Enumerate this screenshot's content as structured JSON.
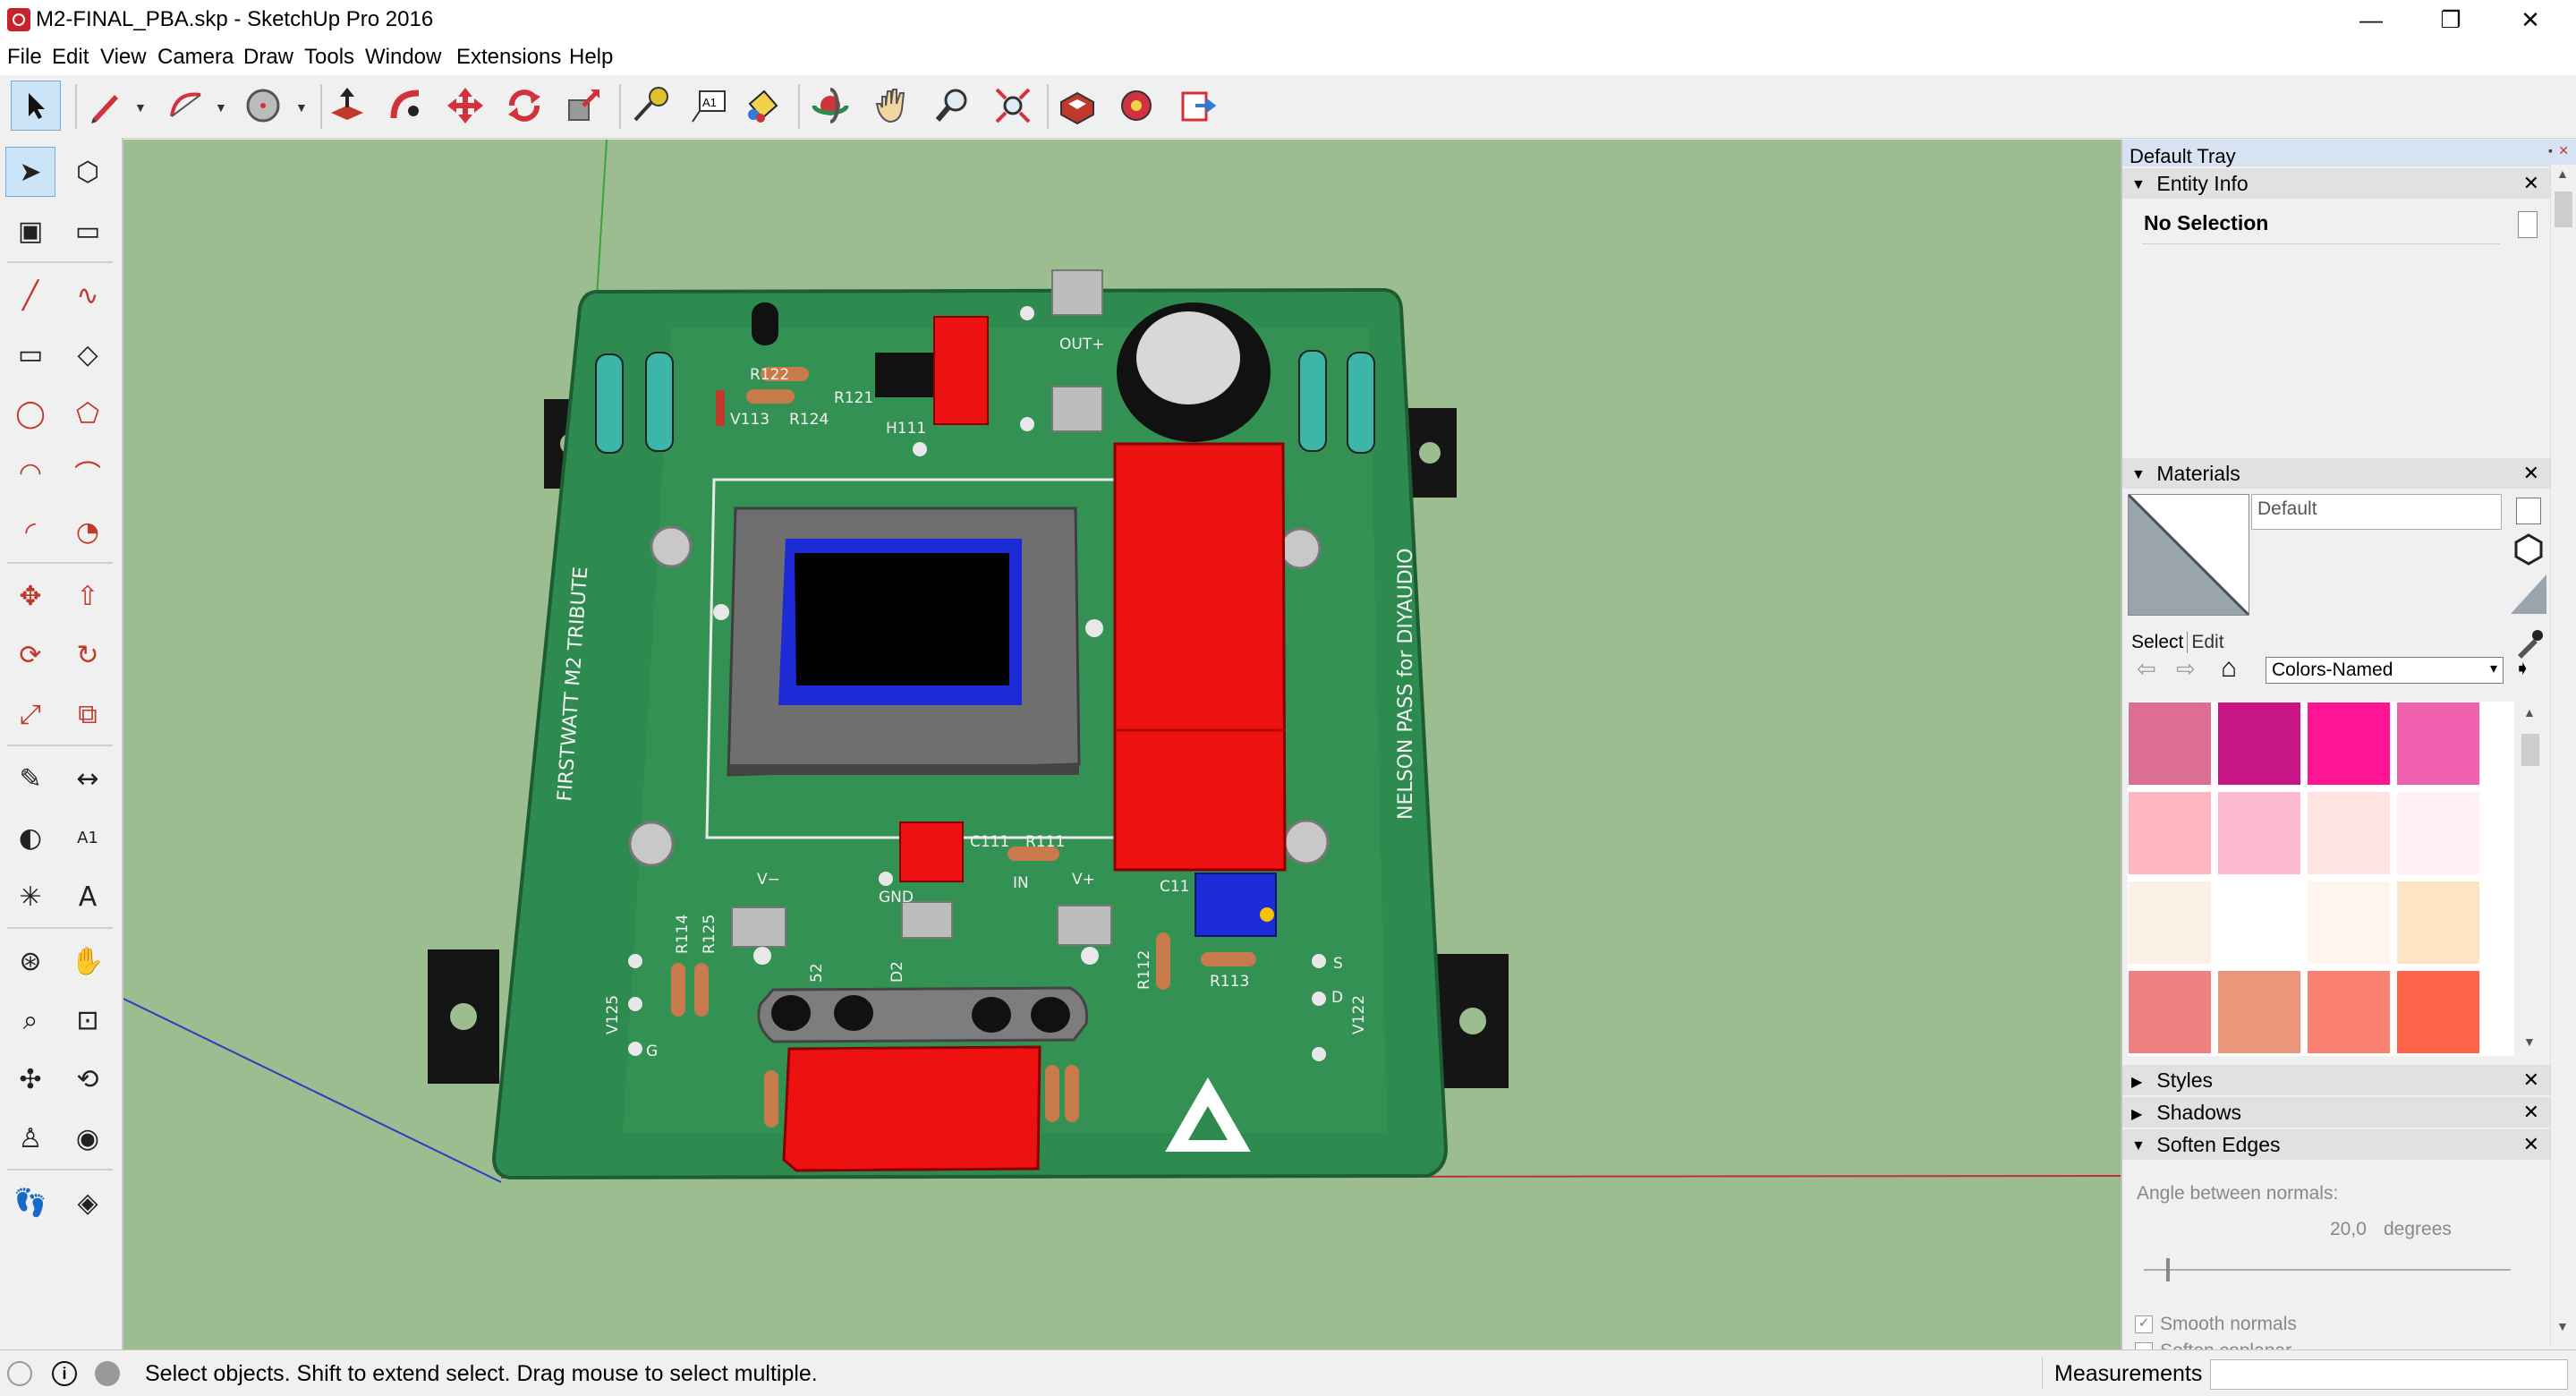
{
  "window": {
    "title": "M2-FINAL_PBA.skp - SketchUp Pro 2016",
    "controls": {
      "minimize": "—",
      "restore": "❐",
      "close": "✕"
    }
  },
  "menu": [
    "File",
    "Edit",
    "View",
    "Camera",
    "Draw",
    "Tools",
    "Window",
    "Extensions",
    "Help"
  ],
  "toolbar": {
    "tools": [
      "select",
      "pencil",
      "arc",
      "circle",
      "push-pull",
      "follow-me",
      "move",
      "rotate",
      "scale",
      "tape-measure",
      "text",
      "paint-bucket",
      "orbit",
      "pan",
      "zoom",
      "zoom-extents",
      "3d-warehouse",
      "extension-warehouse",
      "send-to-layout"
    ],
    "active": "select"
  },
  "left_tools": {
    "rows": [
      [
        "select",
        "component"
      ],
      [
        "paint-bucket",
        "eraser"
      ],
      [
        "line",
        "freehand"
      ],
      [
        "rectangle",
        "rotated-rectangle"
      ],
      [
        "circle",
        "polygon"
      ],
      [
        "arc",
        "two-point-arc"
      ],
      [
        "three-point-arc",
        "pie"
      ],
      [
        "move",
        "push-pull"
      ],
      [
        "rotate",
        "follow-me"
      ],
      [
        "scale",
        "offset"
      ],
      [
        "tape-measure",
        "dimension"
      ],
      [
        "protractor",
        "text"
      ],
      [
        "axes",
        "3d-text"
      ],
      [
        "orbit",
        "pan"
      ],
      [
        "zoom",
        "zoom-window"
      ],
      [
        "zoom-extents",
        "previous-view"
      ],
      [
        "position-camera",
        "look-around"
      ],
      [
        "walk",
        "section-plane"
      ]
    ]
  },
  "viewport": {
    "background": "#9bbd8f",
    "model_labels": {
      "left_edge": "FIRSTWATT M2 TRIBUTE",
      "right_edge": "NELSON PASS for DIYAUDIO",
      "refs": [
        "R122",
        "R121",
        "R124",
        "V113",
        "H111",
        "OUT+",
        "C111",
        "R111",
        "C11",
        "IN",
        "GND",
        "V−",
        "V+",
        "R114",
        "R125",
        "R112",
        "R113",
        "V125",
        "V122",
        "52",
        "D2",
        "G",
        "D",
        "S"
      ]
    }
  },
  "tray": {
    "title": "Default Tray",
    "entity_info": {
      "label": "Entity Info",
      "state": "No Selection"
    },
    "materials": {
      "label": "Materials",
      "name": "Default",
      "tabs": [
        "Select",
        "Edit"
      ],
      "collection": "Colors-Named",
      "swatches": [
        "#dc6e96",
        "#c71585",
        "#ff1493",
        "#f062b0",
        "#ffb6c1",
        "#fcb8cc",
        "#ffe4e1",
        "#fff0f5",
        "#faf0e6",
        "#ffffff",
        "#fff5ee",
        "#ffe4c4",
        "#f08080",
        "#e9967a",
        "#fa8072",
        "#ff6347"
      ]
    },
    "styles": {
      "label": "Styles"
    },
    "shadows": {
      "label": "Shadows"
    },
    "soften_edges": {
      "label": "Soften Edges",
      "angle_label": "Angle between normals:",
      "angle_value": "20,0",
      "angle_unit": "degrees",
      "angle_fraction": 0.06,
      "smooth_normals_label": "Smooth normals",
      "smooth_normals": true,
      "soften_coplanar_label": "Soften coplanar",
      "soften_coplanar": false
    }
  },
  "status": {
    "message": "Select objects. Shift to extend select. Drag mouse to select multiple.",
    "measurements_label": "Measurements",
    "measurements_value": ""
  },
  "colors": {
    "pcb": "#2e8b4f",
    "capacitor_red": "#ee1111",
    "transformer_core": "#6f6f6f",
    "transformer_coil": "#1c2bd6"
  }
}
